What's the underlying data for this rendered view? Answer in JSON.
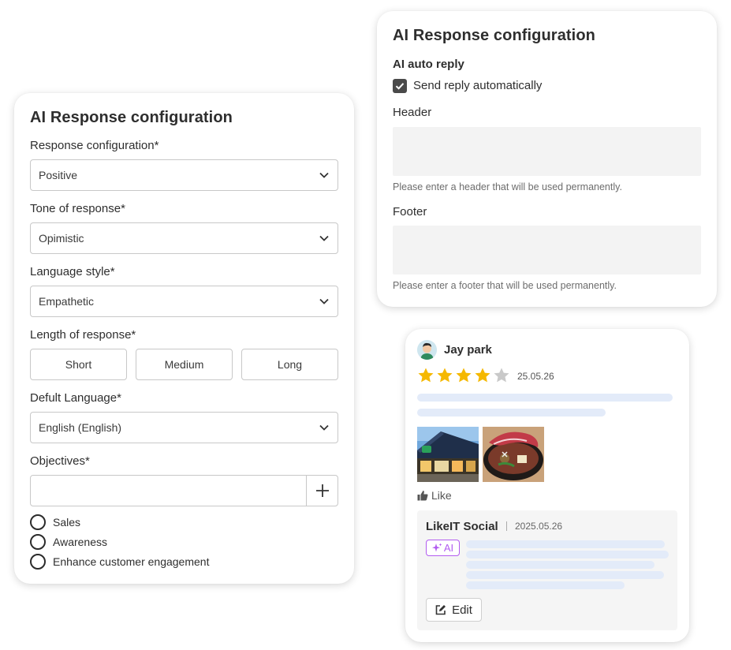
{
  "response_config_card": {
    "title": "AI Response configuration",
    "response_configuration": {
      "label": "Response configuration*",
      "value": "Positive"
    },
    "tone_of_response": {
      "label": "Tone of response*",
      "value": "Opimistic"
    },
    "language_style": {
      "label": "Language style*",
      "value": "Empathetic"
    },
    "length_of_response": {
      "label": "Length of response*",
      "options": [
        "Short",
        "Medium",
        "Long"
      ]
    },
    "default_language": {
      "label": "Defult Language*",
      "value": "English (English)"
    },
    "objectives": {
      "label": "Objectives*",
      "input_value": "",
      "options": [
        "Sales",
        "Awareness",
        "Enhance customer engagement"
      ]
    }
  },
  "auto_reply_card": {
    "title": "AI Response configuration",
    "section_label": "AI auto reply",
    "checkbox_label": "Send reply automatically",
    "checkbox_checked": true,
    "header": {
      "label": "Header",
      "value": "",
      "hint": "Please enter a header that will be used permanently."
    },
    "footer": {
      "label": "Footer",
      "value": "",
      "hint": "Please enter a footer that will be used permanently."
    }
  },
  "review_card": {
    "reviewer_name": "Jay park",
    "rating": 4,
    "rating_max": 5,
    "date": "25.05.26",
    "like_label": "Like",
    "reply": {
      "author": "LikeIT Social",
      "date": "2025.05.26",
      "ai_badge": "AI",
      "edit_label": "Edit"
    }
  },
  "colors": {
    "star_filled": "#f5b800",
    "star_empty": "#c9c9c9",
    "ai_accent": "#b25cf0",
    "skeleton": "#e3ebf9",
    "checkbox": "#4a4a4a"
  },
  "icons": [
    "chevron-down-icon",
    "plus-icon",
    "check-icon",
    "star-icon",
    "thumbs-up-icon",
    "sparkle-icon",
    "edit-icon"
  ]
}
